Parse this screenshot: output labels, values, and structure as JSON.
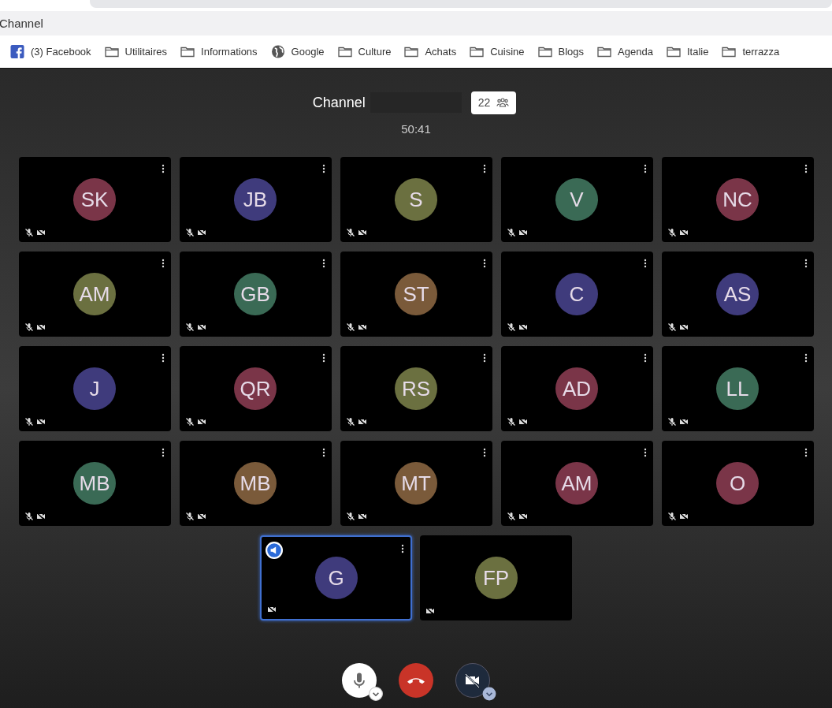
{
  "window": {
    "title": "Channel"
  },
  "bookmarks": [
    {
      "label": "(3) Facebook",
      "kind": "facebook"
    },
    {
      "label": "Utilitaires",
      "kind": "folder"
    },
    {
      "label": "Informations",
      "kind": "folder"
    },
    {
      "label": "Google",
      "kind": "globe"
    },
    {
      "label": "Culture",
      "kind": "folder"
    },
    {
      "label": "Achats",
      "kind": "folder"
    },
    {
      "label": "Cuisine",
      "kind": "folder"
    },
    {
      "label": "Blogs",
      "kind": "folder"
    },
    {
      "label": "Agenda",
      "kind": "folder"
    },
    {
      "label": "Italie",
      "kind": "folder"
    },
    {
      "label": "terrazza",
      "kind": "folder"
    }
  ],
  "call": {
    "title": "Channel",
    "participant_count": "22",
    "timer": "50:41"
  },
  "participants": [
    {
      "initials": "SK",
      "color": "#7a3548",
      "muted": true,
      "selected": false,
      "menu": true,
      "presenter": false
    },
    {
      "initials": "JB",
      "color": "#3f3b7c",
      "muted": true,
      "selected": false,
      "menu": true,
      "presenter": false
    },
    {
      "initials": "S",
      "color": "#6b7040",
      "muted": true,
      "selected": false,
      "menu": true,
      "presenter": false
    },
    {
      "initials": "V",
      "color": "#3a6a55",
      "muted": true,
      "selected": false,
      "menu": true,
      "presenter": false
    },
    {
      "initials": "NC",
      "color": "#7a3548",
      "muted": true,
      "selected": false,
      "menu": true,
      "presenter": false
    },
    {
      "initials": "AM",
      "color": "#6b7040",
      "muted": true,
      "selected": false,
      "menu": true,
      "presenter": false
    },
    {
      "initials": "GB",
      "color": "#3a6a55",
      "muted": true,
      "selected": false,
      "menu": true,
      "presenter": false
    },
    {
      "initials": "ST",
      "color": "#7a5a3a",
      "muted": true,
      "selected": false,
      "menu": true,
      "presenter": false
    },
    {
      "initials": "C",
      "color": "#3f3b7c",
      "muted": true,
      "selected": false,
      "menu": true,
      "presenter": false
    },
    {
      "initials": "AS",
      "color": "#3f3b7c",
      "muted": true,
      "selected": false,
      "menu": true,
      "presenter": false
    },
    {
      "initials": "J",
      "color": "#3f3b7c",
      "muted": true,
      "selected": false,
      "menu": true,
      "presenter": false
    },
    {
      "initials": "QR",
      "color": "#7a3548",
      "muted": true,
      "selected": false,
      "menu": true,
      "presenter": false
    },
    {
      "initials": "RS",
      "color": "#6b7040",
      "muted": true,
      "selected": false,
      "menu": true,
      "presenter": false
    },
    {
      "initials": "AD",
      "color": "#7a3548",
      "muted": true,
      "selected": false,
      "menu": true,
      "presenter": false
    },
    {
      "initials": "LL",
      "color": "#3a6a55",
      "muted": true,
      "selected": false,
      "menu": true,
      "presenter": false
    },
    {
      "initials": "MB",
      "color": "#3a6a55",
      "muted": true,
      "selected": false,
      "menu": true,
      "presenter": false
    },
    {
      "initials": "MB",
      "color": "#7a5a3a",
      "muted": true,
      "selected": false,
      "menu": true,
      "presenter": false
    },
    {
      "initials": "MT",
      "color": "#7a5a3a",
      "muted": true,
      "selected": false,
      "menu": true,
      "presenter": false
    },
    {
      "initials": "AM",
      "color": "#7a3548",
      "muted": true,
      "selected": false,
      "menu": true,
      "presenter": false
    },
    {
      "initials": "O",
      "color": "#7a3548",
      "muted": true,
      "selected": false,
      "menu": true,
      "presenter": false
    },
    {
      "initials": "G",
      "color": "#3f3b7c",
      "muted": false,
      "selected": true,
      "menu": true,
      "presenter": true
    },
    {
      "initials": "FP",
      "color": "#6b7040",
      "muted": false,
      "selected": false,
      "menu": false,
      "presenter": false
    }
  ],
  "controls": {
    "mic_on": true,
    "camera_on": false
  }
}
